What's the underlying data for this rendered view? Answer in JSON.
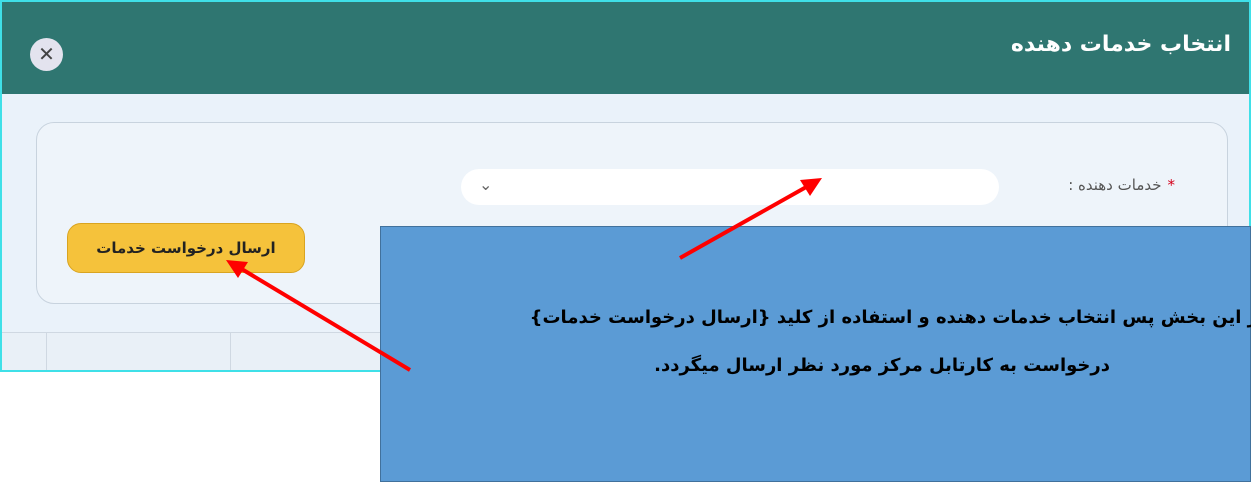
{
  "dialog": {
    "title": "انتخاب خدمات دهنده",
    "close_icon": "close-icon"
  },
  "form": {
    "field_label": "خدمات دهنده :",
    "required_marker": "*",
    "select_value": "",
    "chevron_icon": "chevron-down-icon",
    "submit_label": "ارسال درخواست خدمات"
  },
  "callout": {
    "line1": "ر این بخش پس انتخاب خدمات دهنده و استفاده از کلید {ارسال درخواست خدمات}",
    "line2": "درخواست به کارتابل مرکز مورد نظر ارسال میگردد."
  },
  "colors": {
    "header": "#2f7671",
    "button": "#f5c23b",
    "callout": "#5b9bd5",
    "arrow": "#ff0000"
  }
}
